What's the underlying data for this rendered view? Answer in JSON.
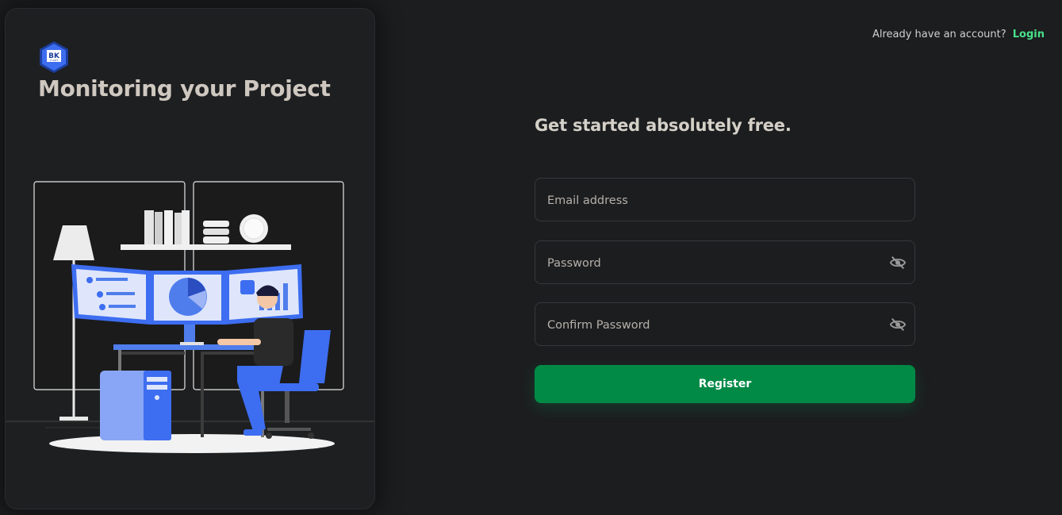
{
  "panel": {
    "logo_text": "BK",
    "logo_subtext": "IT SOFT",
    "title": "Monitoring your Project"
  },
  "header": {
    "prompt": "Already have an account?",
    "login_label": "Login"
  },
  "form": {
    "title": "Get started absolutely free.",
    "email_placeholder": "Email address",
    "email_value": "",
    "password_placeholder": "Password",
    "password_value": "",
    "confirm_placeholder": "Confirm Password",
    "confirm_value": "",
    "register_label": "Register"
  },
  "icons": {
    "visibility": "eye-off-icon"
  },
  "colors": {
    "background": "#1c1d1f",
    "accent": "#008a46",
    "link": "#48e08a",
    "illustration_blue": "#4f7dec"
  }
}
